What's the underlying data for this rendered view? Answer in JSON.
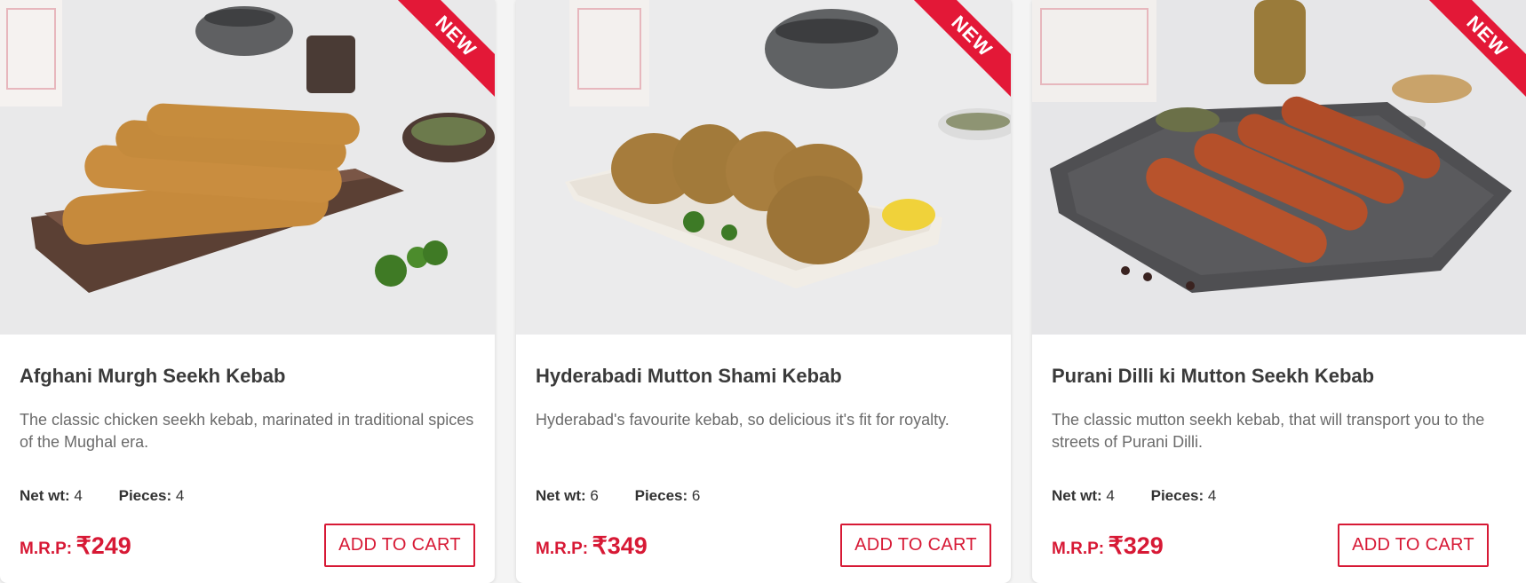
{
  "ribbon_label": "NEW",
  "colors": {
    "accent": "#d71935",
    "ribbon": "#e31837"
  },
  "products": [
    {
      "title": "Afghani Murgh Seekh Kebab",
      "description": "The classic chicken seekh kebab, marinated in traditional spices of the Mughal era.",
      "net_wt_label": "Net wt:",
      "net_wt_value": "4",
      "pieces_label": "Pieces:",
      "pieces_value": "4",
      "mrp_label": "M.R.P:",
      "price": "₹249",
      "button_label": "ADD TO CART"
    },
    {
      "title": "Hyderabadi Mutton Shami Kebab",
      "description": "Hyderabad's favourite kebab, so delicious it's fit for royalty.",
      "net_wt_label": "Net wt:",
      "net_wt_value": "6",
      "pieces_label": "Pieces:",
      "pieces_value": "6",
      "mrp_label": "M.R.P:",
      "price": "₹349",
      "button_label": "ADD TO CART"
    },
    {
      "title": "Purani Dilli ki Mutton Seekh Kebab",
      "description": "The classic mutton seekh kebab, that will transport you to the streets of Purani Dilli.",
      "net_wt_label": "Net wt:",
      "net_wt_value": "4",
      "pieces_label": "Pieces:",
      "pieces_value": "4",
      "mrp_label": "M.R.P:",
      "price": "₹329",
      "button_label": "ADD TO CART"
    }
  ]
}
